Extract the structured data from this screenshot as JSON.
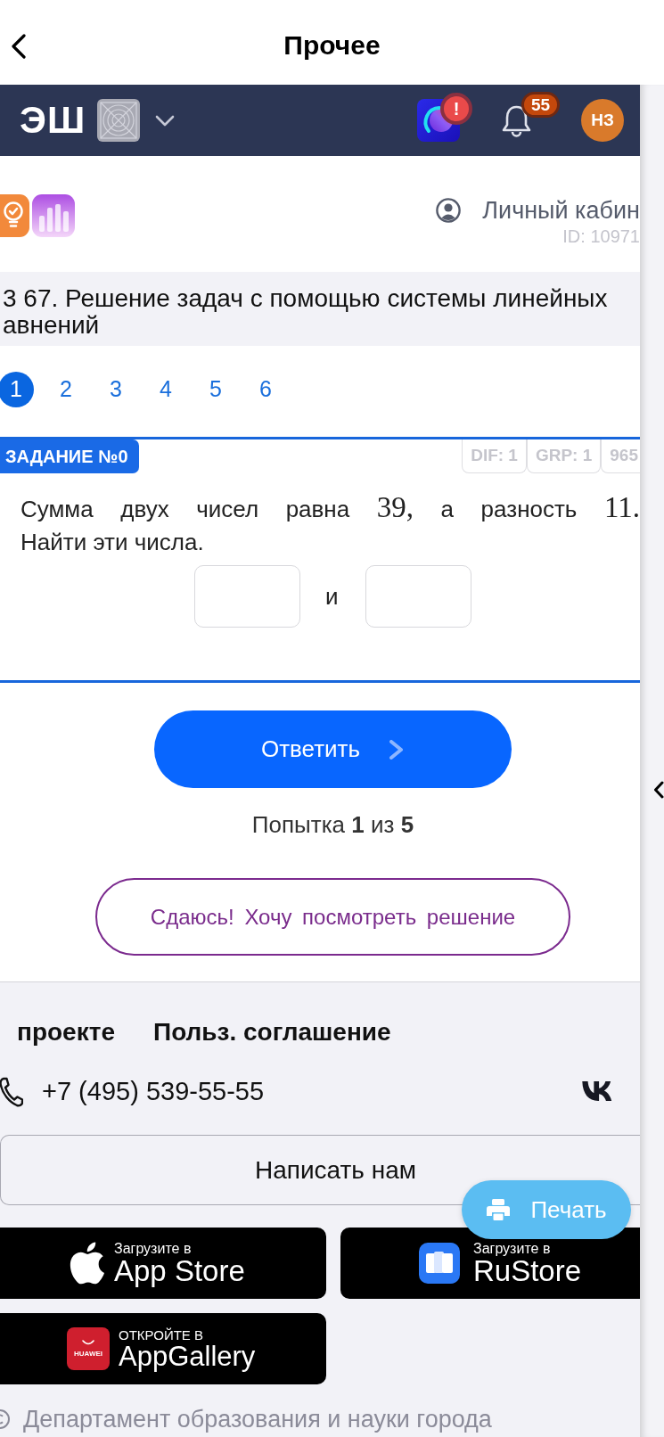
{
  "top_bar": {
    "title": "Прочее"
  },
  "navbar": {
    "logo": "ЭШ",
    "alert_badge": "!",
    "notification_count": "55",
    "avatar_initials": "НЗ"
  },
  "account": {
    "label": "Личный кабин",
    "id": "ID: 10971"
  },
  "lesson": {
    "title_lines": [
      "3 67. Решение задач с помощью системы линейных",
      "авнений"
    ]
  },
  "pagination": [
    {
      "label": "1",
      "selected": true
    },
    {
      "label": "2",
      "selected": false
    },
    {
      "label": "3",
      "selected": false
    },
    {
      "label": "4",
      "selected": false
    },
    {
      "label": "5",
      "selected": false
    },
    {
      "label": "6",
      "selected": false
    }
  ],
  "task": {
    "badge": "ЗАДАНИЕ №0",
    "tags": [
      "DIF: 1",
      "GRP: 1",
      "965"
    ],
    "question_lines": [
      [
        {
          "kind": "text",
          "text": "Сумма двух чисел равна"
        },
        {
          "kind": "math",
          "text": "39,"
        },
        {
          "kind": "text",
          "text": "а разность"
        },
        {
          "kind": "math",
          "text": "11."
        }
      ],
      [
        {
          "kind": "text",
          "text": "Найти эти числа."
        }
      ]
    ],
    "answer_separator": "и"
  },
  "submit_button": "Ответить",
  "attempt": "Попытка **1** из **5**",
  "give_up_button": "Сдаюсь! Хочу посмотреть решение",
  "footer": {
    "links": [
      "проекте",
      "Польз. соглашение"
    ],
    "phone": "+7 (495) 539-55-55",
    "contact_button": "Написать нам",
    "stores": [
      {
        "kind": "apple",
        "caption": "Загрузите в",
        "name": "App Store"
      },
      {
        "kind": "rustore",
        "caption": "Загрузите в",
        "name": "RuStore"
      },
      {
        "kind": "huawei",
        "caption": "ОТКРОЙТЕ В",
        "name": "AppGallery",
        "icon_text": "HUAWEI"
      }
    ],
    "copyright": "Департамент образования и науки города"
  },
  "print_button": "Печать"
}
